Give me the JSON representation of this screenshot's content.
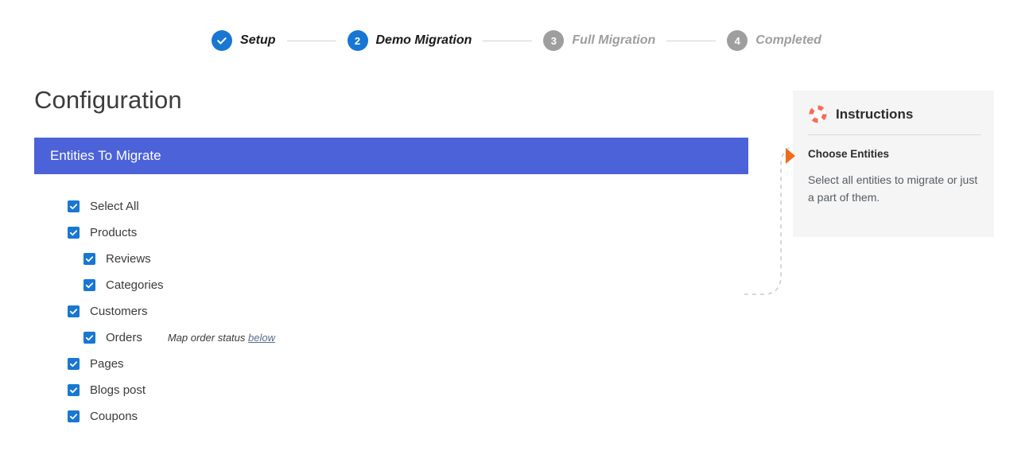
{
  "stepper": {
    "steps": [
      {
        "marker": "check",
        "label": "Setup",
        "state": "done"
      },
      {
        "marker": "2",
        "label": "Demo Migration",
        "state": "active"
      },
      {
        "marker": "3",
        "label": "Full Migration",
        "state": "todo"
      },
      {
        "marker": "4",
        "label": "Completed",
        "state": "todo"
      }
    ],
    "active_color": "#1877d2",
    "inactive_color": "#9e9e9e"
  },
  "page": {
    "title": "Configuration"
  },
  "entities_panel": {
    "header": "Entities To Migrate",
    "header_color": "#4c62d9",
    "items": [
      {
        "label": "Select All",
        "checked": true,
        "level": 0,
        "note": null,
        "note_link": null
      },
      {
        "label": "Products",
        "checked": true,
        "level": 0,
        "note": null,
        "note_link": null
      },
      {
        "label": "Reviews",
        "checked": true,
        "level": 1,
        "note": null,
        "note_link": null
      },
      {
        "label": "Categories",
        "checked": true,
        "level": 1,
        "note": null,
        "note_link": null
      },
      {
        "label": "Customers",
        "checked": true,
        "level": 0,
        "note": null,
        "note_link": null
      },
      {
        "label": "Orders",
        "checked": true,
        "level": 1,
        "note": "Map order status",
        "note_link": "below"
      },
      {
        "label": "Pages",
        "checked": true,
        "level": 0,
        "note": null,
        "note_link": null
      },
      {
        "label": "Blogs post",
        "checked": true,
        "level": 0,
        "note": null,
        "note_link": null
      },
      {
        "label": "Coupons",
        "checked": true,
        "level": 0,
        "note": null,
        "note_link": null
      }
    ],
    "checkbox_color": "#1877d2"
  },
  "instructions": {
    "icon": "lifebuoy-icon",
    "title": "Instructions",
    "subtitle": "Choose Entities",
    "body": "Select all entities to migrate or just a part of them.",
    "pointer_color": "#ef6c1a",
    "background": "#f5f5f5"
  }
}
